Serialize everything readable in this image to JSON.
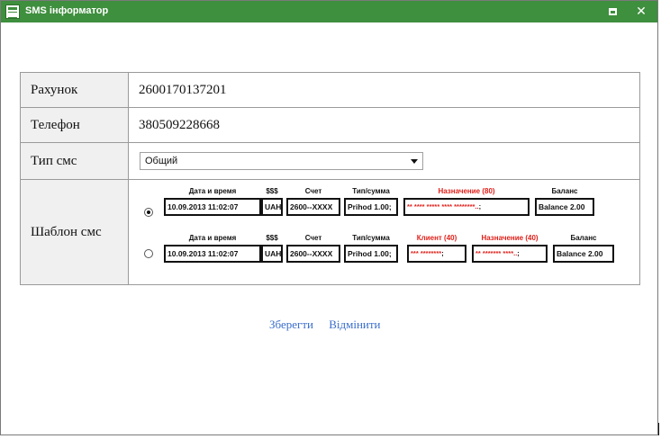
{
  "window": {
    "title": "SMS інформатор"
  },
  "form": {
    "account": {
      "label": "Рахунок",
      "value": "2600170137201"
    },
    "phone": {
      "label": "Телефон",
      "value": "380509228668"
    },
    "sms_type": {
      "label": "Тип смс",
      "selected": "Общий"
    },
    "template": {
      "label": "Шаблон смс",
      "options": [
        {
          "selected": true,
          "fields": [
            {
              "caption": "Дата и время",
              "value": "10.09.2013  11:02:07",
              "red": false
            },
            {
              "caption": "$$$",
              "value": "UAH",
              "red": false
            },
            {
              "caption": "Счет",
              "value": "2600--XXXX",
              "red": false
            },
            {
              "caption": "Тип/сумма",
              "value": "Prihod 1.00;",
              "red": false
            },
            {
              "caption": "Назначение (80)",
              "value": "** **** ***** **** ********..",
              "tail": ";",
              "red": true
            },
            {
              "caption": "Баланс",
              "value": "Balance 2.00",
              "red": false
            }
          ]
        },
        {
          "selected": false,
          "fields": [
            {
              "caption": "Дата и время",
              "value": "10.09.2013  11:02:07",
              "red": false
            },
            {
              "caption": "$$$",
              "value": "UAH",
              "red": false
            },
            {
              "caption": "Счет",
              "value": "2600--XXXX",
              "red": false
            },
            {
              "caption": "Тип/сумма",
              "value": "Prihod 1.00;",
              "red": false
            },
            {
              "caption": "Клиент (40)",
              "value": "*** ********",
              "tail": ";",
              "red": true
            },
            {
              "caption": "Назначение (40)",
              "value": "** ******* ****..",
              "tail": ";",
              "red": true
            },
            {
              "caption": "Баланс",
              "value": "Balance 2.00",
              "red": false
            }
          ]
        }
      ]
    }
  },
  "actions": {
    "save": "Зберегти",
    "cancel": "Відмінити"
  },
  "colors": {
    "titlebar": "#3e8f3e",
    "link": "#3a6ecb",
    "highlight": "#e0201a"
  },
  "icons": {
    "app": "app-window-icon",
    "maximize": "maximize-icon",
    "close": "close-icon",
    "dropdown": "chevron-down-icon"
  }
}
